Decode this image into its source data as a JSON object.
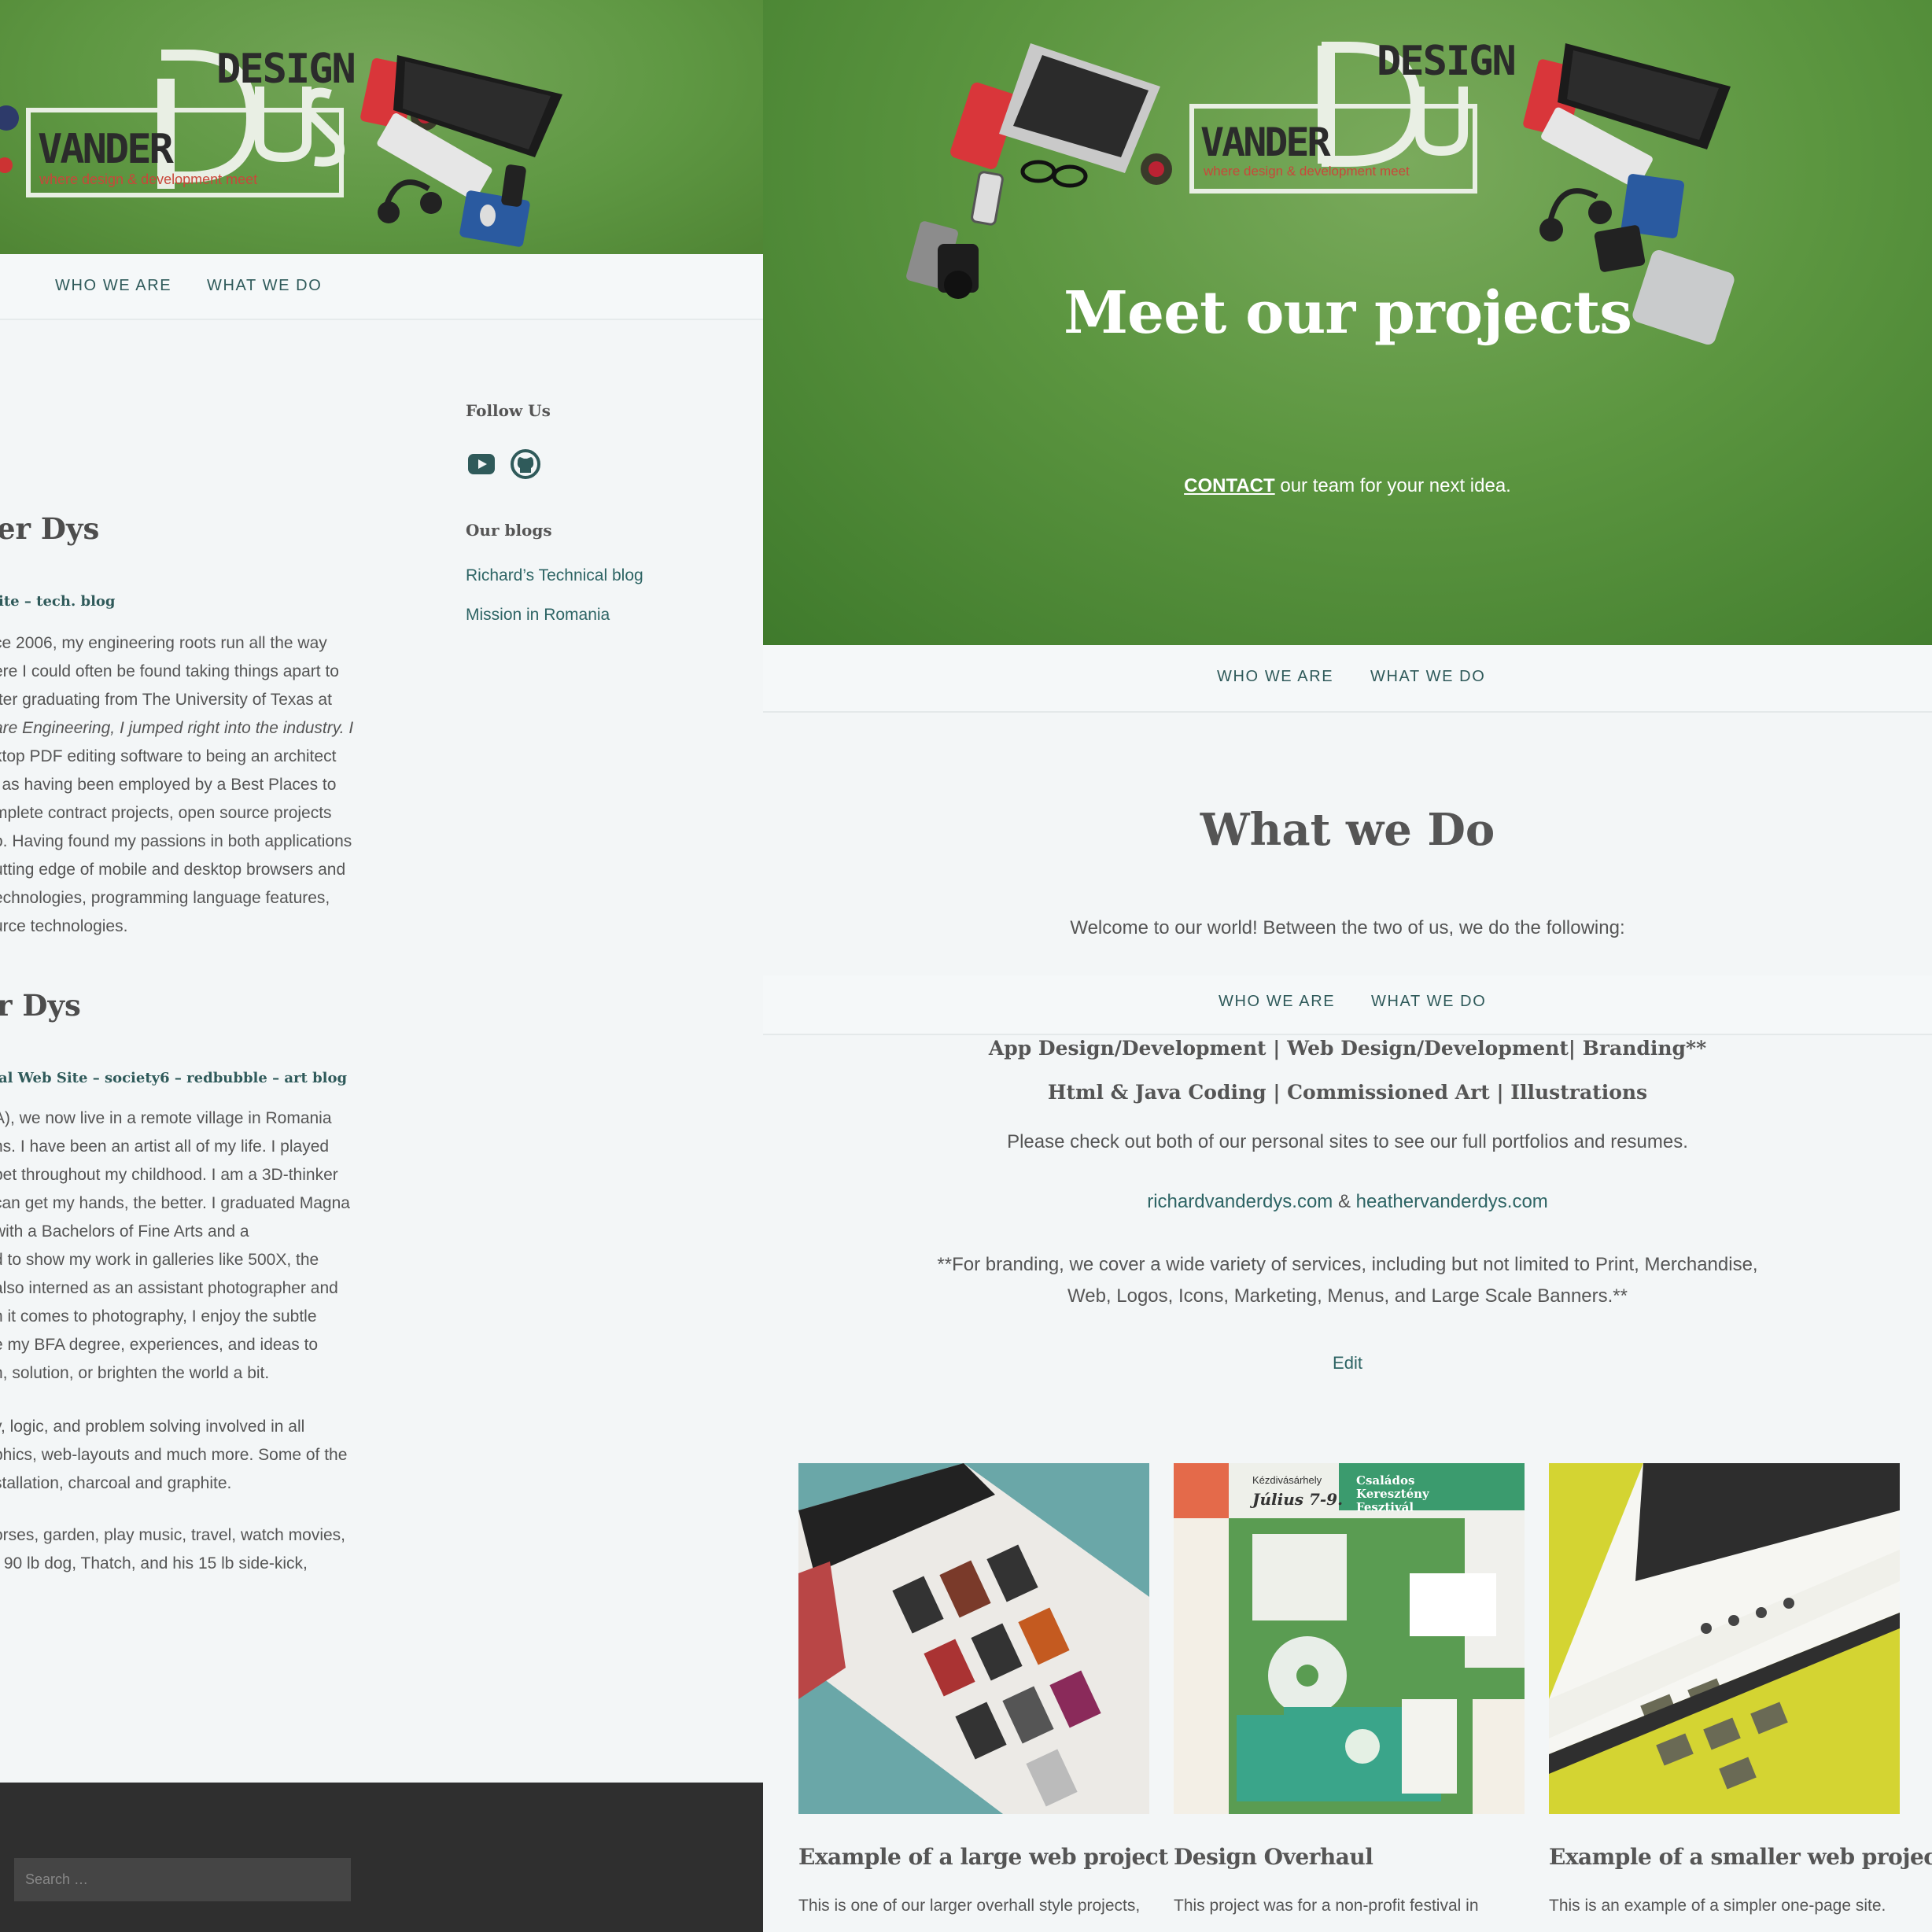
{
  "left": {
    "logo": {
      "word1": "DESIGN",
      "word2": "VANDER",
      "word3": "Dys",
      "tagline": "where design & development meet"
    },
    "nav": [
      "WHO WE ARE",
      "WHAT WE DO"
    ],
    "widgets": {
      "follow_title": "Follow Us",
      "social": [
        {
          "icon": "youtube-icon"
        },
        {
          "icon": "github-icon"
        }
      ],
      "blogs_title": "Our blogs",
      "blogs": [
        "Richard’s Technical blog",
        "Mission in Romania"
      ]
    },
    "person1": {
      "heading": "er Dys",
      "sub": "ite – tech. blog",
      "lines": [
        "ce 2006, my engineering roots run all the way",
        "ere I could often be found taking things apart to",
        "fter graduating from The University of Texas at",
        "are Engineering, I jumped right into the industry. I",
        "ktop PDF editing software to being an architect",
        "l as having been employed by a Best Places to",
        "mplete contract projects, open source projects",
        "o. Having found my passions in both applications",
        "utting edge of mobile and desktop browsers and",
        "echnologies, programming language features,",
        "urce technologies."
      ]
    },
    "person2": {
      "heading": "r Dys",
      "sub": "al Web Site – society6 – redbubble – art blog",
      "lines": [
        "A), we now live in a remote village in Romania",
        "ns. I have been an artist all of my life. I played",
        "pet throughout my childhood. I am a 3D-thinker",
        "can get my hands, the better. I graduated Magna",
        " with a Bachelors of Fine Arts and a",
        "d to show my work in galleries like 500X, the",
        "also interned as an assistant photographer and",
        "n it comes to photography, I enjoy the subtle",
        "e my BFA degree, experiences, and ideas to",
        "n, solution, or brighten the world a bit."
      ],
      "lines2": [
        "y, logic, and problem solving involved in all",
        "phics, web-layouts and much more. Some of the",
        "stallation, charcoal and graphite."
      ],
      "lines3": [
        "orses, garden, play music, travel, watch movies,",
        "r 90 lb dog, Thatch, and his 15 lb side-kick,"
      ]
    },
    "search_placeholder": "Search …"
  },
  "right": {
    "hero": {
      "title": "Meet our projects",
      "cta_link": "CONTACT",
      "cta_rest": " our team for your next idea."
    },
    "nav": [
      "WHO WE ARE",
      "WHAT WE DO"
    ],
    "section_title": "What we Do",
    "intro": "Welcome to our world! Between the two of us, we do the following:",
    "services_line1": "App Design/Development | Web Design/Development| Branding**",
    "services_line2": "Html & Java Coding | Commissioned Art | Illustrations",
    "portfolio_line": "Please check out both of our personal sites to see our full portfolios and resumes.",
    "site1": "richardvanderdys.com",
    "amp": " & ",
    "site2": "heathervanderdys.com",
    "branding_note": "**For branding, we cover a wide variety of services, including but not limited to Print, Merchandise, Web, Logos, Icons, Marketing, Menus, and Large Scale Banners.**",
    "edit": "Edit",
    "cards": [
      {
        "title": "Example of a large web project",
        "text": "This is one of our larger overhall style projects,",
        "bg": "#6aa7a8"
      },
      {
        "title": "Design Overhaul",
        "text": "This project was for a non-profit festival in",
        "bg": "#5a9c52"
      },
      {
        "title": "Example of a smaller web project",
        "text": "This is an example of a simpler one-page site.",
        "bg": "#d4d432"
      }
    ],
    "festival": {
      "name1": "Családos",
      "name2": "Keresztény",
      "name3": "Fesztivál",
      "date": "Július 7-9.",
      "city": "Kézdivásárhely"
    }
  },
  "colors": {
    "hero_green": "#5f9843",
    "link_teal": "#2d6464",
    "footer_dark": "#2f2f2f"
  }
}
